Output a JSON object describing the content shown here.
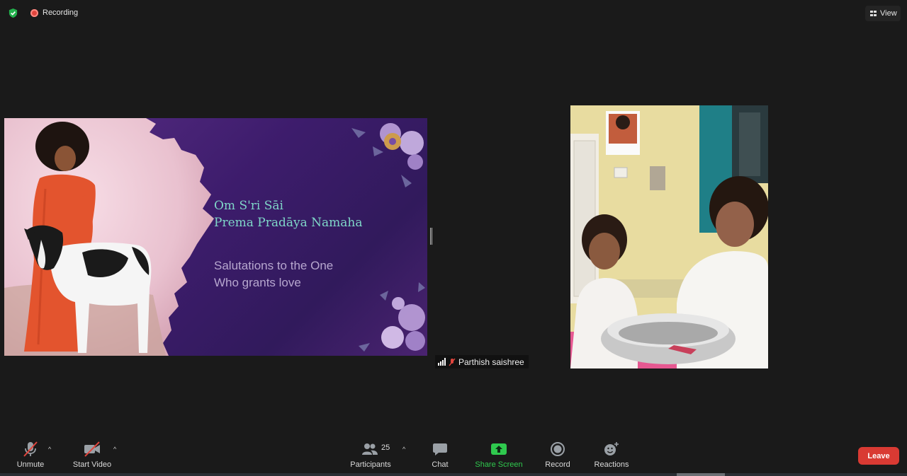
{
  "topbar": {
    "recording_label": "Recording",
    "view_label": "View",
    "security_icon": "shield-check-icon",
    "recording_icon": "record-dot-icon"
  },
  "presentation": {
    "title_line1": "Om S'ri Sāi",
    "title_line2": "Prema Pradāya Namaha",
    "subtitle_line1": "Salutations to the One",
    "subtitle_line2": "Who grants love",
    "colors": {
      "title": "#7fd6c8",
      "subtitle": "#b7a7cf",
      "background": "#3d1c6c"
    }
  },
  "participant": {
    "name": "Parthish saishree",
    "muted": true
  },
  "toolbar": {
    "unmute_label": "Unmute",
    "start_video_label": "Start Video",
    "participants_label": "Participants",
    "participants_count": "25",
    "chat_label": "Chat",
    "share_screen_label": "Share Screen",
    "record_label": "Record",
    "reactions_label": "Reactions",
    "leave_label": "Leave",
    "colors": {
      "share_screen": "#2fc94e",
      "leave": "#d93a33",
      "muted_slash": "#e0453d"
    }
  }
}
